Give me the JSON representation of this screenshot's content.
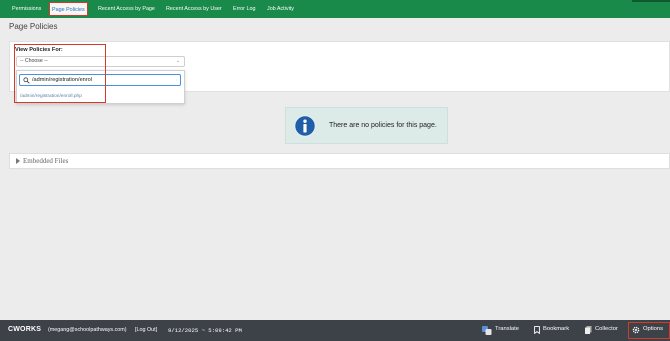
{
  "nav": {
    "tabs": [
      {
        "label": "Permissions"
      },
      {
        "label": "Page Policies"
      },
      {
        "label": "Recent Access by Page"
      },
      {
        "label": "Recent Access by User"
      },
      {
        "label": "Error Log"
      },
      {
        "label": "Job Activity"
      }
    ],
    "active_tab": "Page Policies"
  },
  "page": {
    "title": "Page Policies"
  },
  "policies_form": {
    "label": "View Policies For:",
    "select_value": "-- Choose --",
    "search_value": "/admin/registration/enrol",
    "results": [
      "/admin/registration/enroll.php"
    ]
  },
  "notice": {
    "message": "There are no policies for this page."
  },
  "embedded": {
    "label": "Embedded Files"
  },
  "footer": {
    "brand": "CWORKS",
    "user_email": "(megang@schoolpathways.com)",
    "logout_label": "[Log Out]",
    "timestamp": "9/12/2025 ~ 5:09:42 PM",
    "translate_label": "Translate",
    "bookmark_label": "Bookmark",
    "collector_label": "Collector",
    "options_label": "Options"
  },
  "colors": {
    "nav_bg": "#1a8a4a",
    "footer_bg": "#3d4148",
    "notice_bg": "#dcebe8",
    "highlight": "#d23a2a",
    "link": "#5b7fa8"
  }
}
